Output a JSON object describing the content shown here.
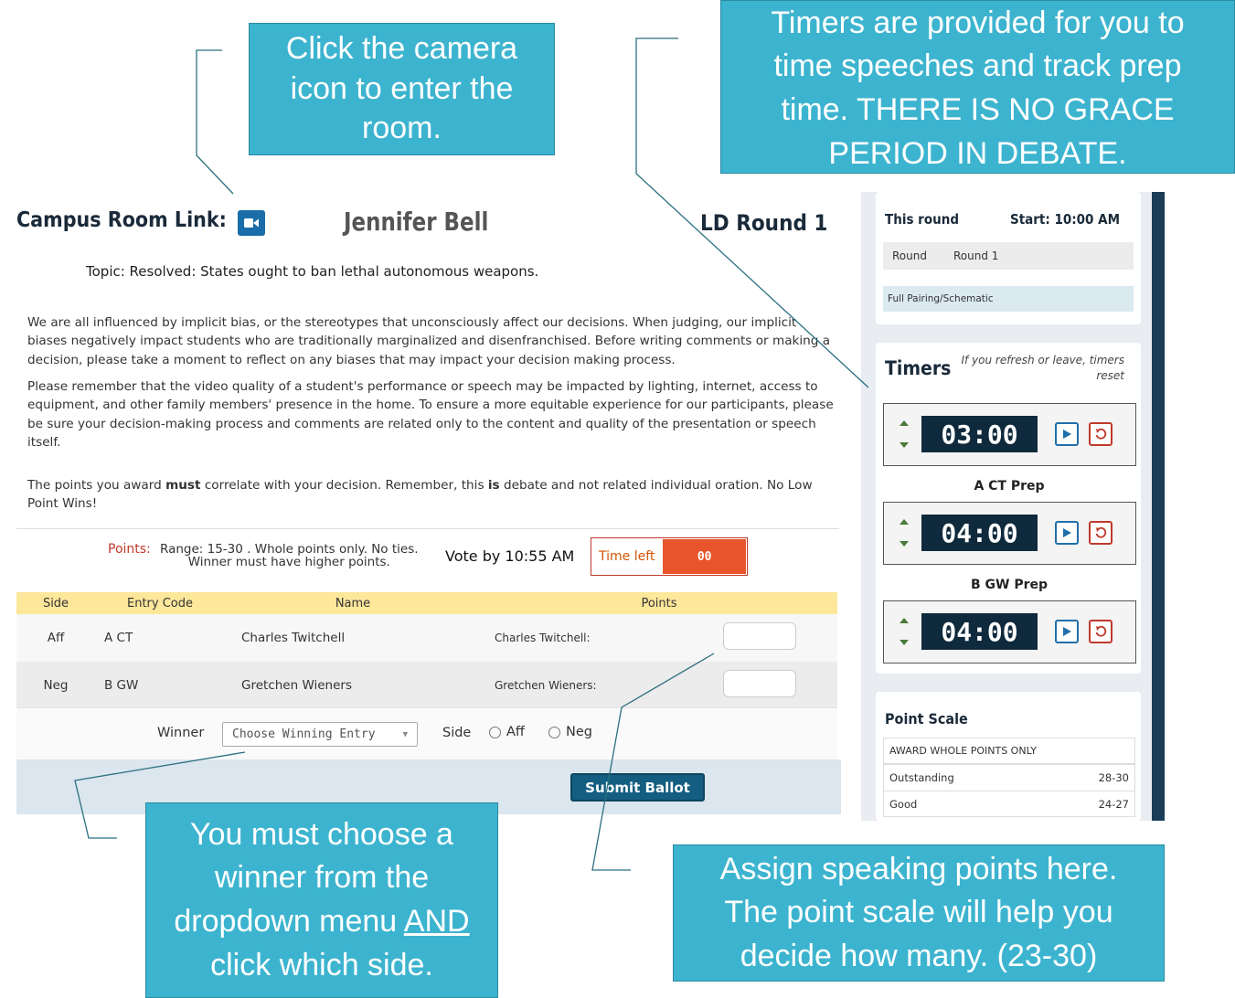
{
  "header": {
    "campus_label": "Campus Room Link:",
    "judge_name": "Jennifer Bell",
    "round_title": "LD Round 1"
  },
  "topic": "Topic: Resolved: States ought to ban lethal autonomous weapons.",
  "paragraphs": [
    "We are all influenced by implicit bias, or the stereotypes that unconsciously affect our decisions. When judging, our implicit biases negatively impact students who are traditionally marginalized and disenfranchised. Before writing comments or making a decision, please take a moment to reflect on any biases that may impact your decision making process.",
    "Please remember that the video quality of a student's performance or speech may be impacted by lighting, internet, access to equipment, and other family members' presence in the home. To ensure a more equitable experience for our participants, please be sure your decision-making process and comments are related only to the content and quality of the presentation or speech itself."
  ],
  "points_notice": {
    "part1": "The points you award ",
    "must": "must",
    "part2": " correlate with your decision. Remember, this ",
    "is": "is",
    "part3": " debate and not related individual oration. No Low Point Wins!"
  },
  "points_info": {
    "label": "Points:",
    "line1": "Range: 15-30 . Whole points only. No ties.",
    "line2": "Winner must have higher points."
  },
  "vote_by": "Vote by 10:55 AM",
  "time_left": {
    "label": "Time left",
    "value": "00"
  },
  "table": {
    "headers": [
      "Side",
      "Entry Code",
      "Name",
      "Points"
    ],
    "rows": [
      {
        "side": "Aff",
        "code": "A CT",
        "name": "Charles Twitchell",
        "points_label": "Charles Twitchell:"
      },
      {
        "side": "Neg",
        "code": "B GW",
        "name": "Gretchen Wieners",
        "points_label": "Gretchen Wieners:"
      }
    ]
  },
  "winner": {
    "label": "Winner",
    "select_value": "Choose Winning Entry",
    "side_label": "Side",
    "options": [
      "Aff",
      "Neg"
    ]
  },
  "submit_label": "Submit Ballot",
  "sidebar": {
    "this_round": "This round",
    "start": "Start: 10:00 AM",
    "round_label": "Round",
    "round_value": "Round 1",
    "pairing_link": "Full Pairing/Schematic",
    "timers_title": "Timers",
    "timers_note": "If you refresh or leave, timers reset",
    "timers": [
      {
        "time": "03:00",
        "label": "A CT Prep"
      },
      {
        "time": "04:00",
        "label": "B GW Prep"
      },
      {
        "time": "04:00",
        "label": ""
      }
    ],
    "point_scale_title": "Point Scale",
    "point_scale_header": "AWARD WHOLE POINTS ONLY",
    "point_scale": [
      {
        "label": "Outstanding",
        "range": "28-30"
      },
      {
        "label": "Good",
        "range": "24-27"
      }
    ]
  },
  "callouts": {
    "camera": "Click the camera icon to enter the room.",
    "timers": "Timers are provided for you to time speeches and track prep time. THERE IS NO GRACE PERIOD IN DEBATE.",
    "winner_pre": "You must choose a winner from the dropdown menu ",
    "winner_and": "AND",
    "winner_post": " click which side.",
    "points": "Assign speaking points here. The point scale will help you decide how many. (23-30)"
  },
  "colors": {
    "callout": "#3db4cf",
    "accent": "#135e81",
    "header_row": "#fde79a",
    "time_left": "#e8552a"
  }
}
